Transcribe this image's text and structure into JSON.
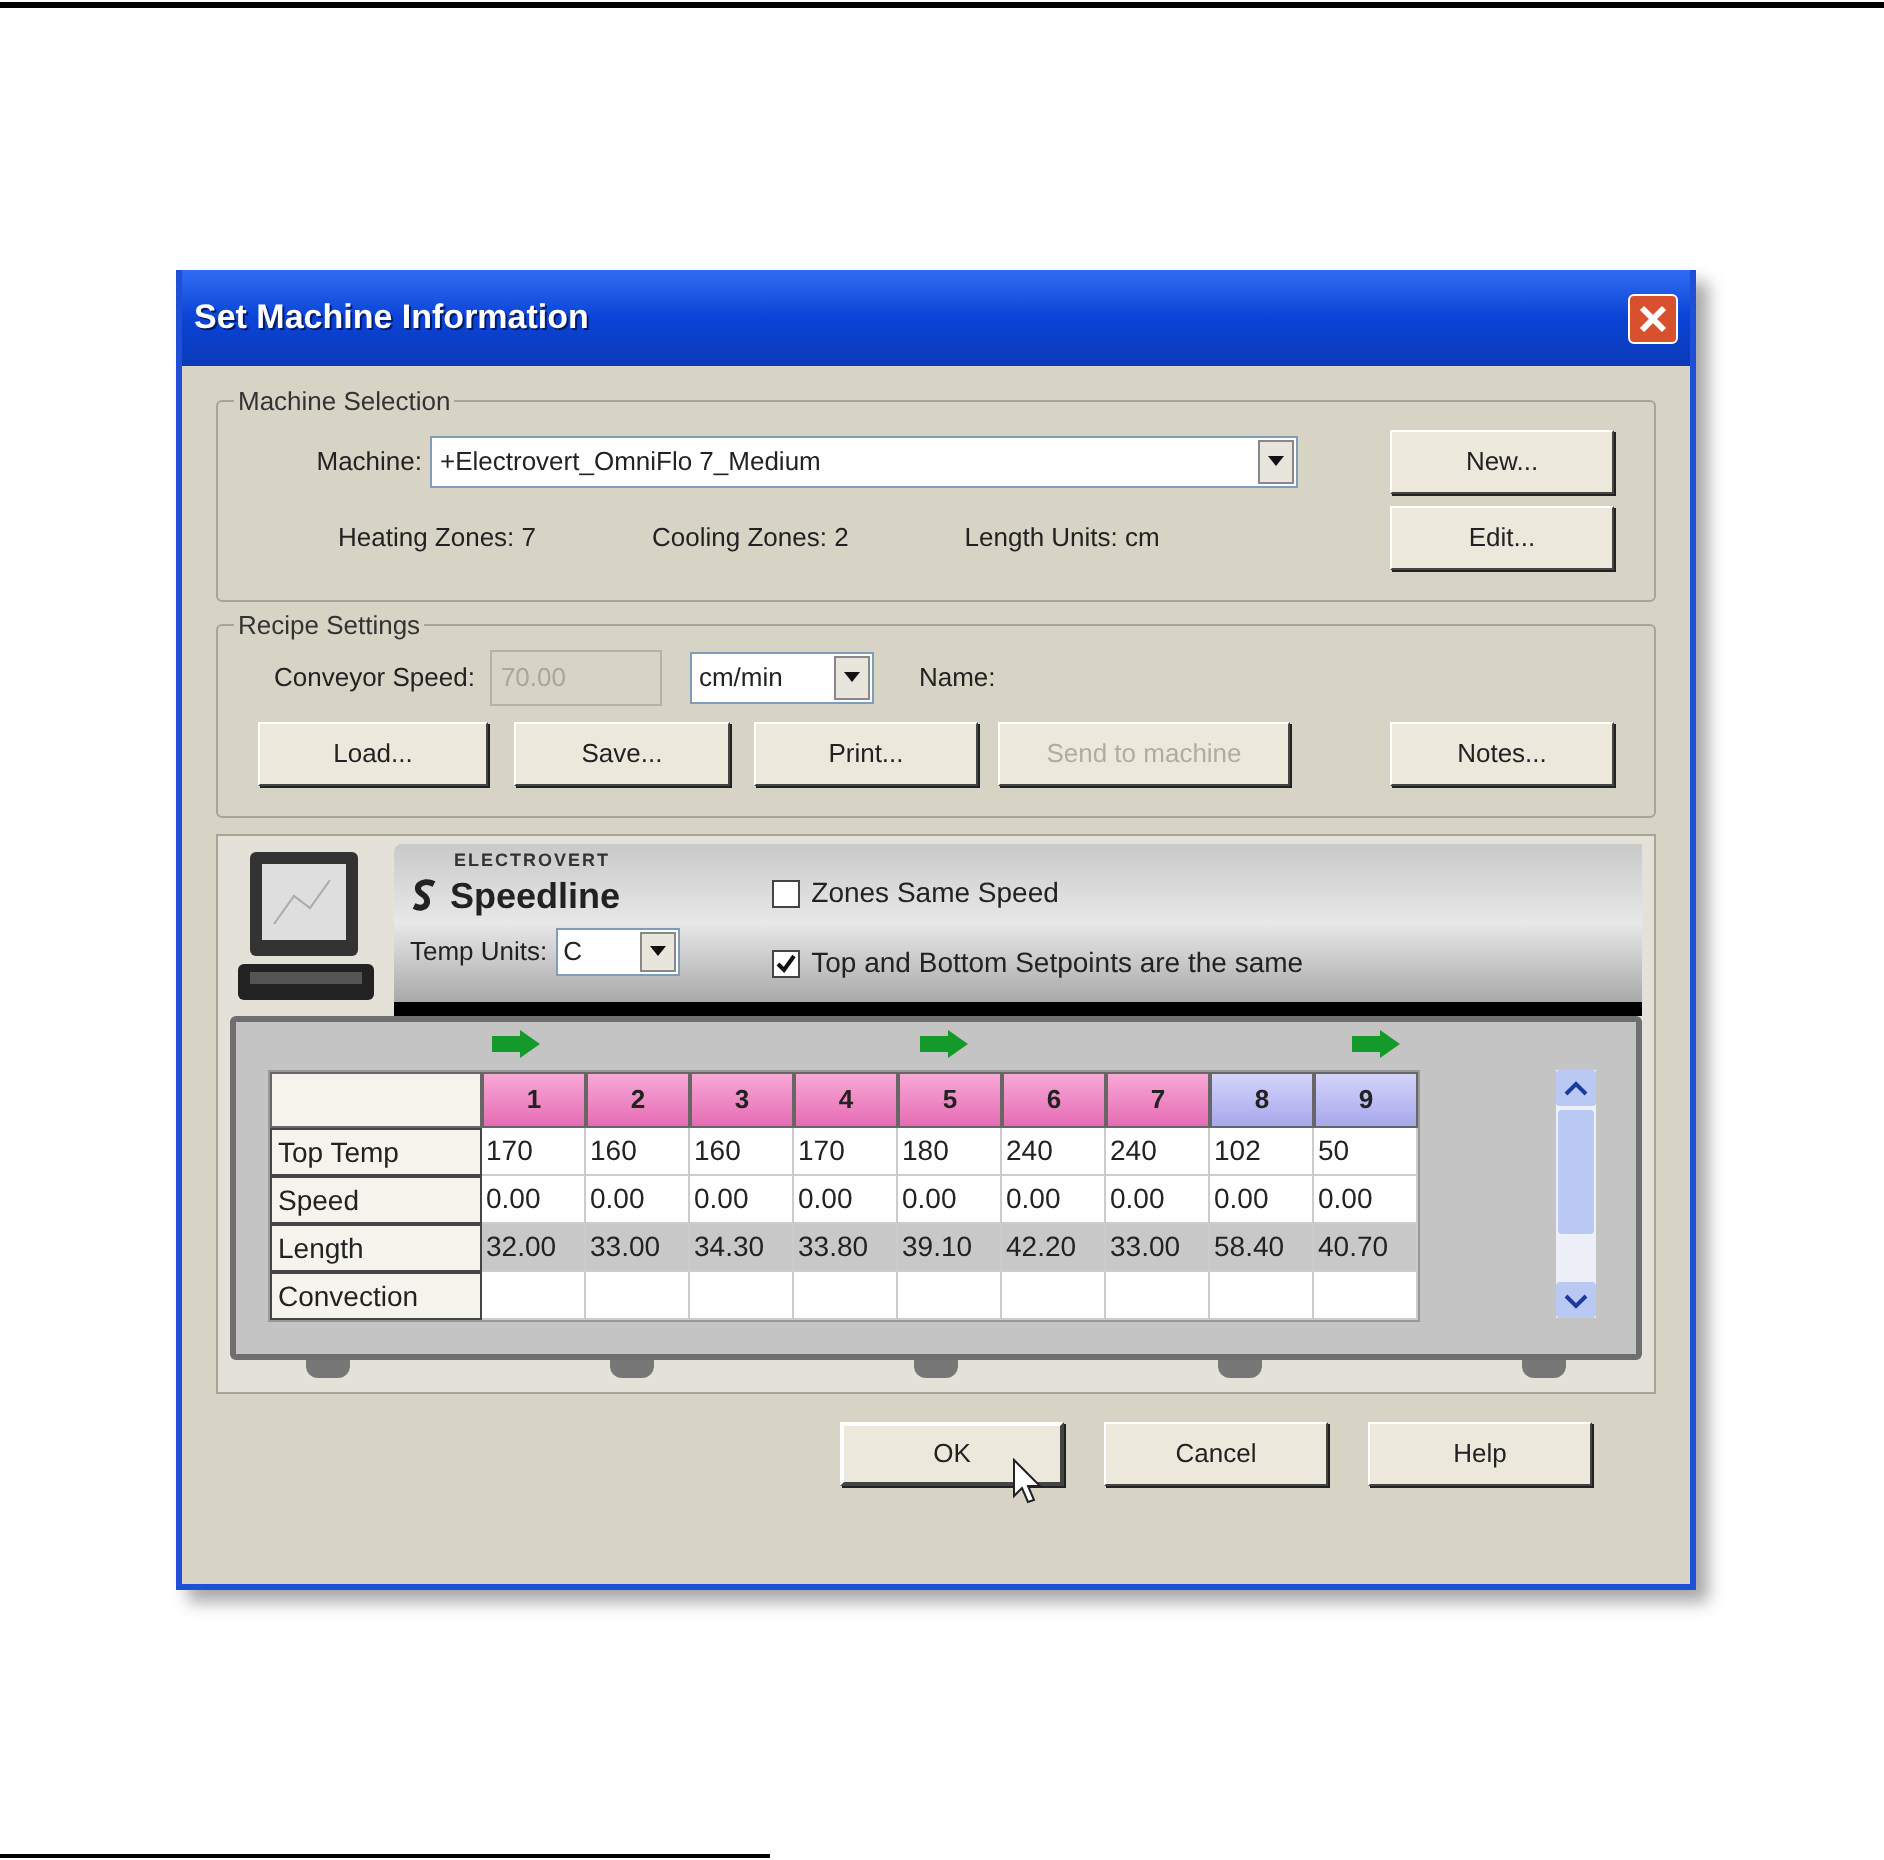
{
  "window": {
    "title": "Set Machine Information"
  },
  "machine_selection": {
    "title": "Machine Selection",
    "machine_label": "Machine:",
    "machine_value": "+Electrovert_OmniFlo 7_Medium",
    "heating_zones": "Heating Zones: 7",
    "cooling_zones": "Cooling Zones: 2",
    "length_units": "Length Units: cm",
    "buttons": [
      {
        "label": "New..."
      },
      {
        "label": "Edit..."
      }
    ]
  },
  "recipe_settings": {
    "title": "Recipe Settings",
    "conveyor_speed_label": "Conveyor Speed:",
    "conveyor_speed_value": "70.00",
    "conveyor_speed_disabled": true,
    "speed_units": "cm/min",
    "name_label": "Name:",
    "buttons": [
      {
        "label": "Load...",
        "disabled": false
      },
      {
        "label": "Save...",
        "disabled": false
      },
      {
        "label": "Print...",
        "disabled": false
      },
      {
        "label": "Send to machine",
        "disabled": true
      },
      {
        "label": "Notes...",
        "disabled": false
      }
    ]
  },
  "profile": {
    "brand_top": "ELECTROVERT",
    "brand": "Speedline",
    "temp_units_label": "Temp Units:",
    "temp_units": "C",
    "options": [
      {
        "label": "Zones Same Speed",
        "checked": false
      },
      {
        "label": "Top and Bottom Setpoints are the same",
        "checked": true
      }
    ],
    "zones": [
      {
        "label": "1",
        "kind": "heating"
      },
      {
        "label": "2",
        "kind": "heating"
      },
      {
        "label": "3",
        "kind": "heating"
      },
      {
        "label": "4",
        "kind": "heating"
      },
      {
        "label": "5",
        "kind": "heating"
      },
      {
        "label": "6",
        "kind": "heating"
      },
      {
        "label": "7",
        "kind": "heating"
      },
      {
        "label": "8",
        "kind": "cooling"
      },
      {
        "label": "9",
        "kind": "cooling"
      }
    ],
    "rows": [
      {
        "label": "Top Temp",
        "selected": false,
        "values": [
          "170",
          "160",
          "160",
          "170",
          "180",
          "240",
          "240",
          "102",
          "50"
        ]
      },
      {
        "label": "Speed",
        "selected": false,
        "values": [
          "0.00",
          "0.00",
          "0.00",
          "0.00",
          "0.00",
          "0.00",
          "0.00",
          "0.00",
          "0.00"
        ]
      },
      {
        "label": "Length",
        "selected": true,
        "values": [
          "32.00",
          "33.00",
          "34.30",
          "33.80",
          "39.10",
          "42.20",
          "33.00",
          "58.40",
          "40.70"
        ]
      },
      {
        "label": "Convection",
        "selected": false
      }
    ]
  },
  "buttons": [
    {
      "label": "OK",
      "default": true
    },
    {
      "label": "Cancel",
      "default": false
    },
    {
      "label": "Help",
      "default": false
    }
  ]
}
